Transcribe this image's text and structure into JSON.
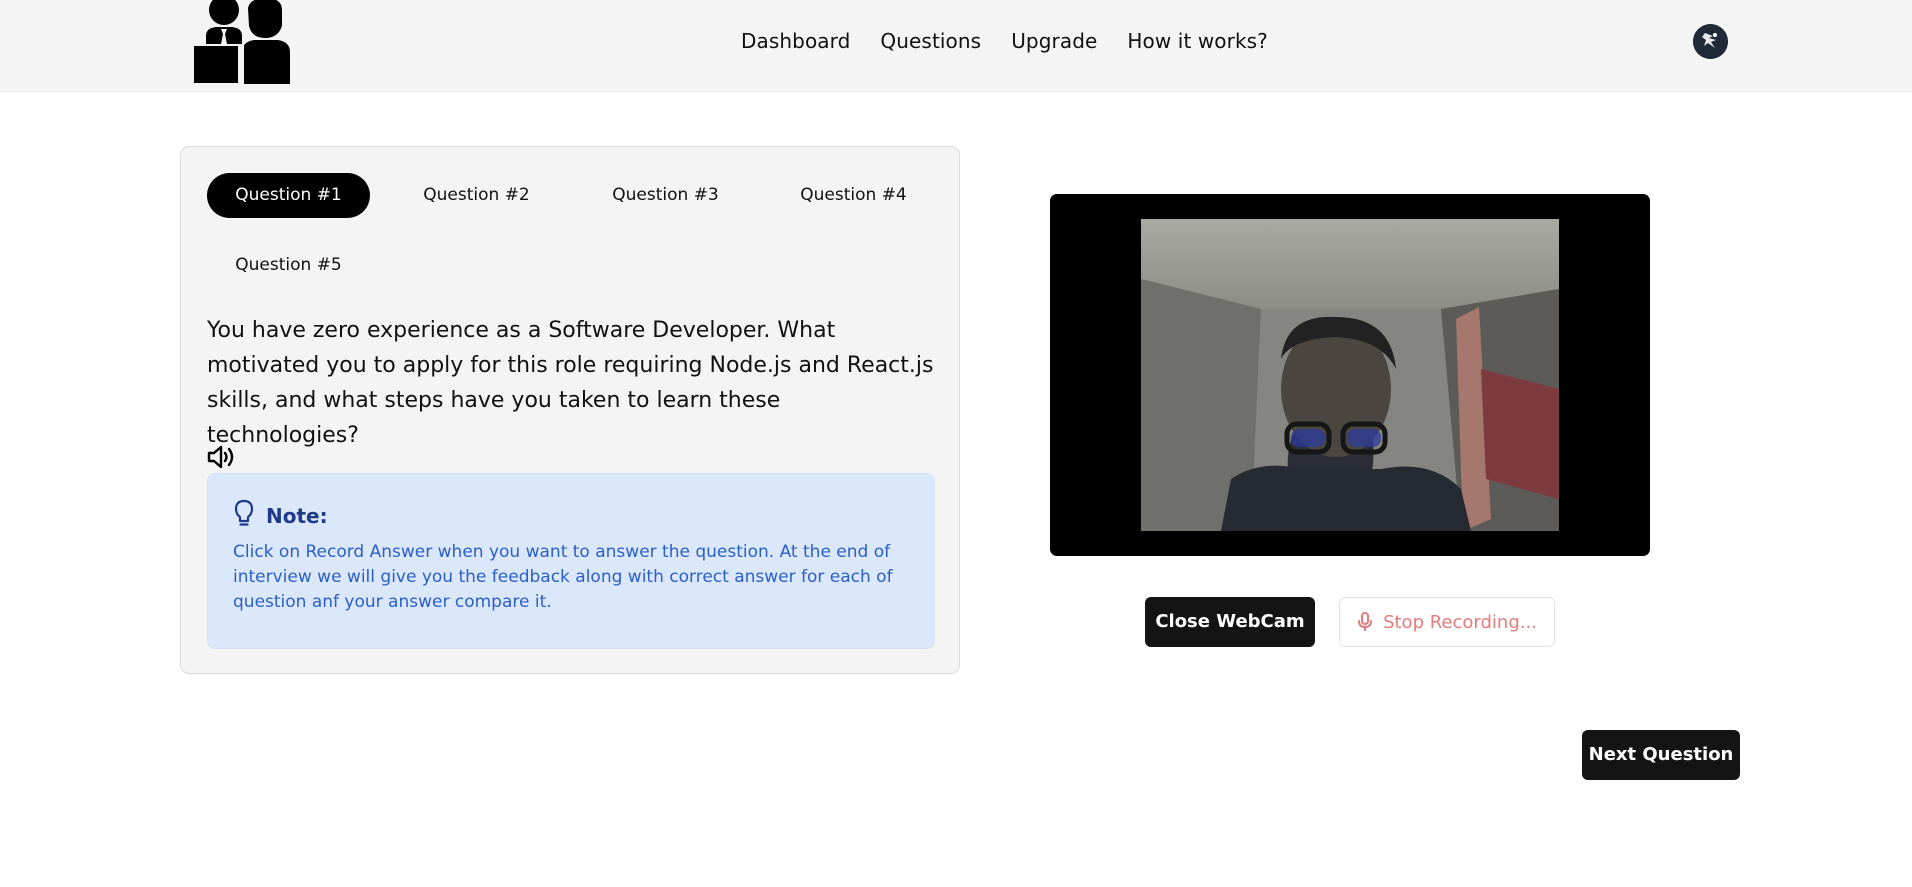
{
  "nav": {
    "items": [
      "Dashboard",
      "Questions",
      "Upgrade",
      "How it works?"
    ]
  },
  "tabs": [
    {
      "label": "Question #1",
      "active": true
    },
    {
      "label": "Question #2",
      "active": false
    },
    {
      "label": "Question #3",
      "active": false
    },
    {
      "label": "Question #4",
      "active": false
    },
    {
      "label": "Question #5",
      "active": false
    }
  ],
  "question": {
    "text": "You have zero experience as a Software Developer. What motivated you to apply for this role requiring Node.js and React.js skills, and what steps have you taken to learn these technologies?"
  },
  "note": {
    "title": "Note:",
    "text": "Click on Record Answer when you want to answer the question. At the end of interview we will give you the feedback along with correct answer for each of question anf your answer compare it."
  },
  "controls": {
    "close_webcam": "Close WebCam",
    "stop_recording": "Stop Recording...",
    "next_question": "Next Question"
  },
  "colors": {
    "header_bg": "#f4f4f4",
    "note_bg": "#dbe7fb",
    "note_title": "#1e3a8a",
    "note_text": "#2b5fc8",
    "recording_red": "#e57b7b"
  }
}
